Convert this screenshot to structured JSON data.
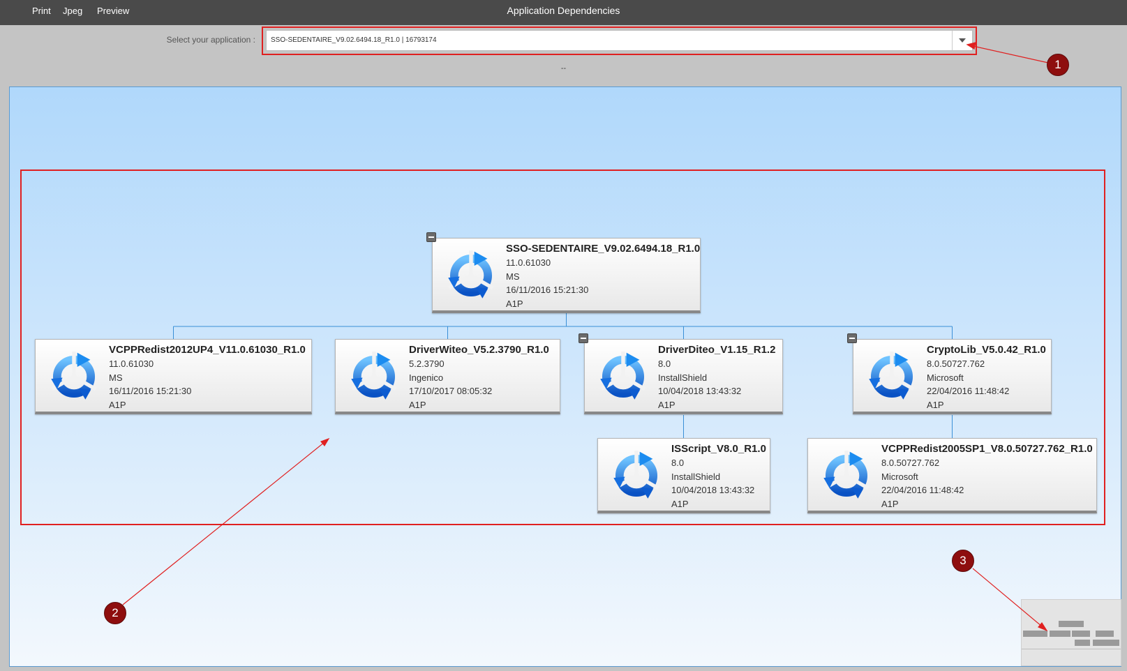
{
  "menu": {
    "print": "Print",
    "jpeg": "Jpeg",
    "preview": "Preview"
  },
  "app_title": "Application Dependencies",
  "selector": {
    "label": "Select your application :",
    "value": "SSO-SEDENTAIRE_V9.02.6494.18_R1.0 | 16793174"
  },
  "status_text": "--",
  "nodes": [
    {
      "name": "SSO-SEDENTAIRE_V9.02.6494.18_R1.0",
      "version": "11.0.61030",
      "vendor": "MS",
      "date": "16/11/2016 15:21:30",
      "code": "A1P"
    },
    {
      "name": "VCPPRedist2012UP4_V11.0.61030_R1.0",
      "version": "11.0.61030",
      "vendor": "MS",
      "date": "16/11/2016 15:21:30",
      "code": "A1P"
    },
    {
      "name": "DriverWiteo_V5.2.3790_R1.0",
      "version": "5.2.3790",
      "vendor": "Ingenico",
      "date": "17/10/2017 08:05:32",
      "code": "A1P"
    },
    {
      "name": "DriverDiteo_V1.15_R1.2",
      "version": "8.0",
      "vendor": "InstallShield",
      "date": "10/04/2018 13:43:32",
      "code": "A1P"
    },
    {
      "name": "CryptoLib_V5.0.42_R1.0",
      "version": "8.0.50727.762",
      "vendor": "Microsoft",
      "date": "22/04/2016 11:48:42",
      "code": "A1P"
    },
    {
      "name": "ISScript_V8.0_R1.0",
      "version": "8.0",
      "vendor": "InstallShield",
      "date": "10/04/2018 13:43:32",
      "code": "A1P"
    },
    {
      "name": "VCPPRedist2005SP1_V8.0.50727.762_R1.0",
      "version": "8.0.50727.762",
      "vendor": "Microsoft",
      "date": "22/04/2016 11:48:42",
      "code": "A1P"
    }
  ],
  "annotations": [
    "1",
    "2",
    "3"
  ],
  "colors": {
    "highlight": "#e02020",
    "annotation": "#8e0e0e",
    "connector": "#3a8fd6",
    "icon": "#1a7ae8"
  }
}
